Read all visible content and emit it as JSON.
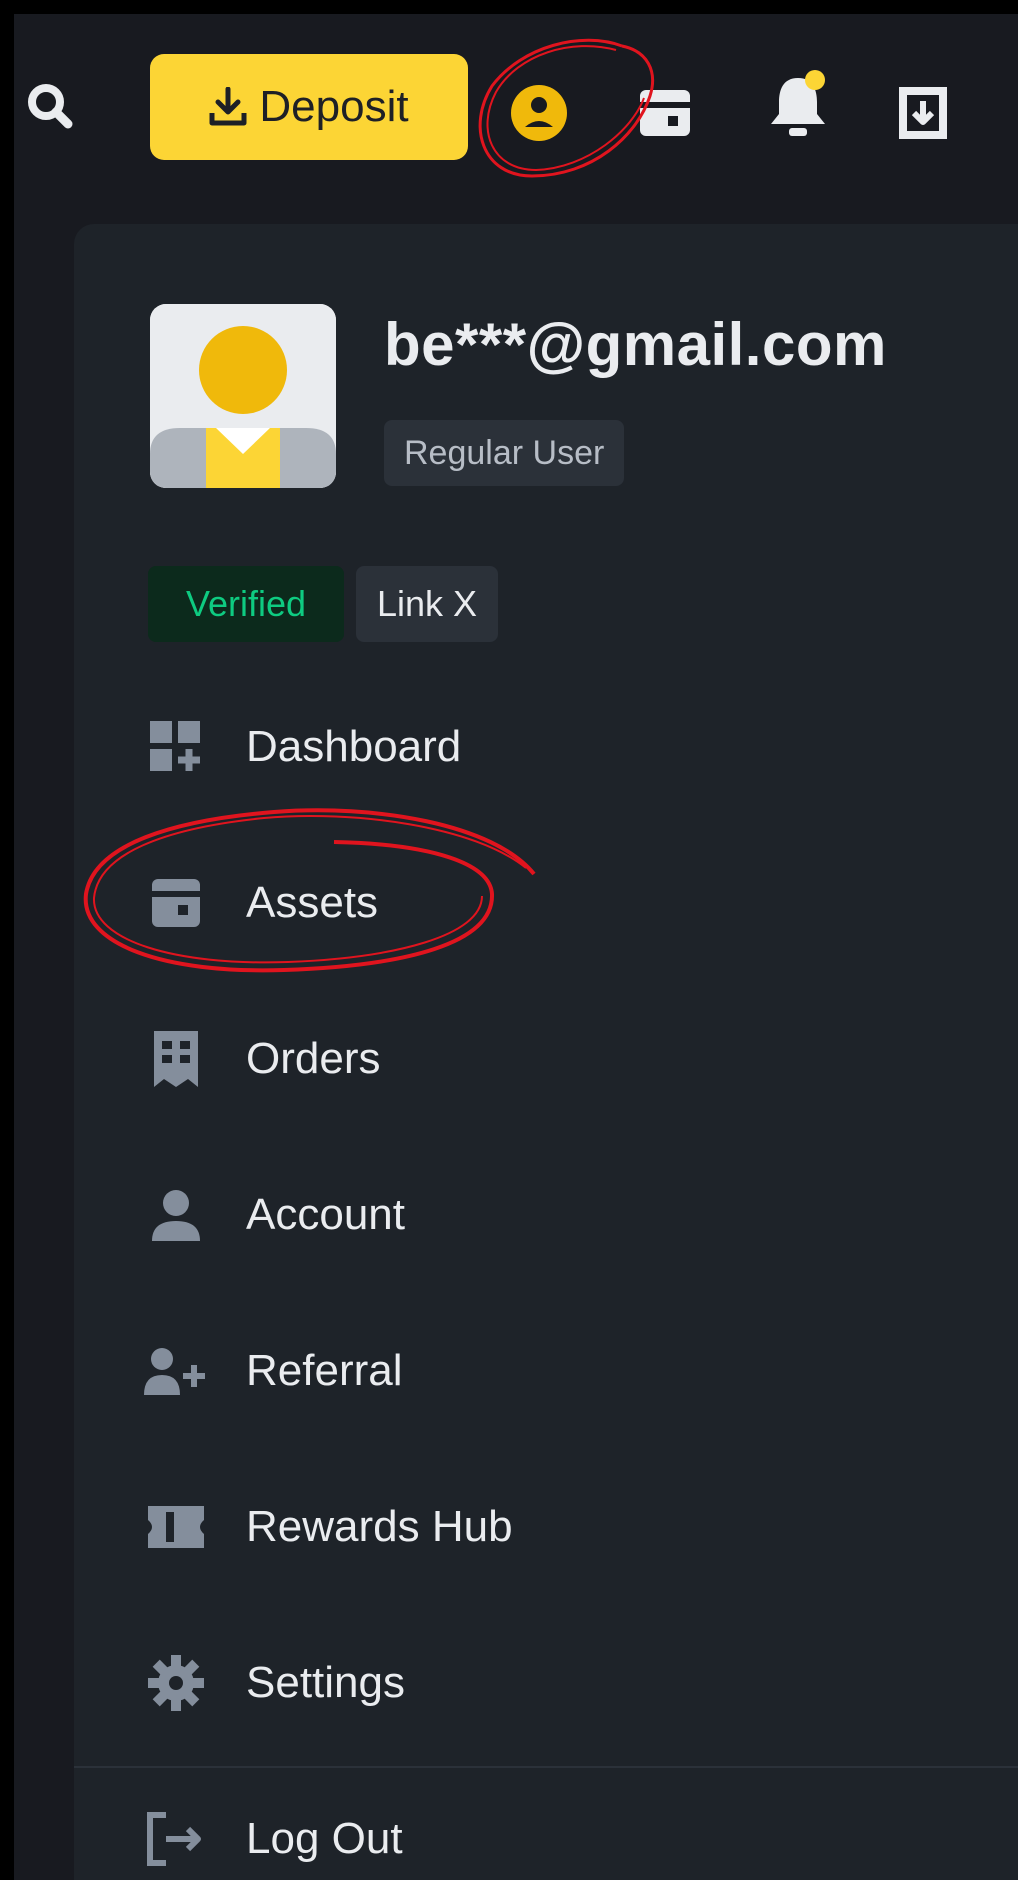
{
  "topbar": {
    "search_icon": "search-icon",
    "deposit_label": "Deposit",
    "deposit_icon": "download-icon",
    "profile_icon": "user-circle-icon",
    "wallet_icon": "wallet-icon",
    "bell_icon": "bell-icon",
    "download_icon": "download-app-icon"
  },
  "profile": {
    "email": "be***@gmail.com",
    "level": "Regular User",
    "badges": {
      "verified": "Verified",
      "link": "Link X"
    }
  },
  "menu": {
    "items": [
      {
        "label": "Dashboard",
        "icon": "dashboard-icon"
      },
      {
        "label": "Assets",
        "icon": "wallet-icon"
      },
      {
        "label": "Orders",
        "icon": "orders-icon"
      },
      {
        "label": "Account",
        "icon": "user-icon"
      },
      {
        "label": "Referral",
        "icon": "user-plus-icon"
      },
      {
        "label": "Rewards Hub",
        "icon": "ticket-icon"
      },
      {
        "label": "Settings",
        "icon": "gear-icon"
      }
    ],
    "logout": {
      "label": "Log Out",
      "icon": "logout-icon"
    }
  },
  "colors": {
    "accent": "#fcd535",
    "background": "#181a20",
    "panel": "#1e2329",
    "text": "#eaecef",
    "icon": "#848e9c",
    "verified": "#0ecb81",
    "annotation": "#e0141e"
  }
}
